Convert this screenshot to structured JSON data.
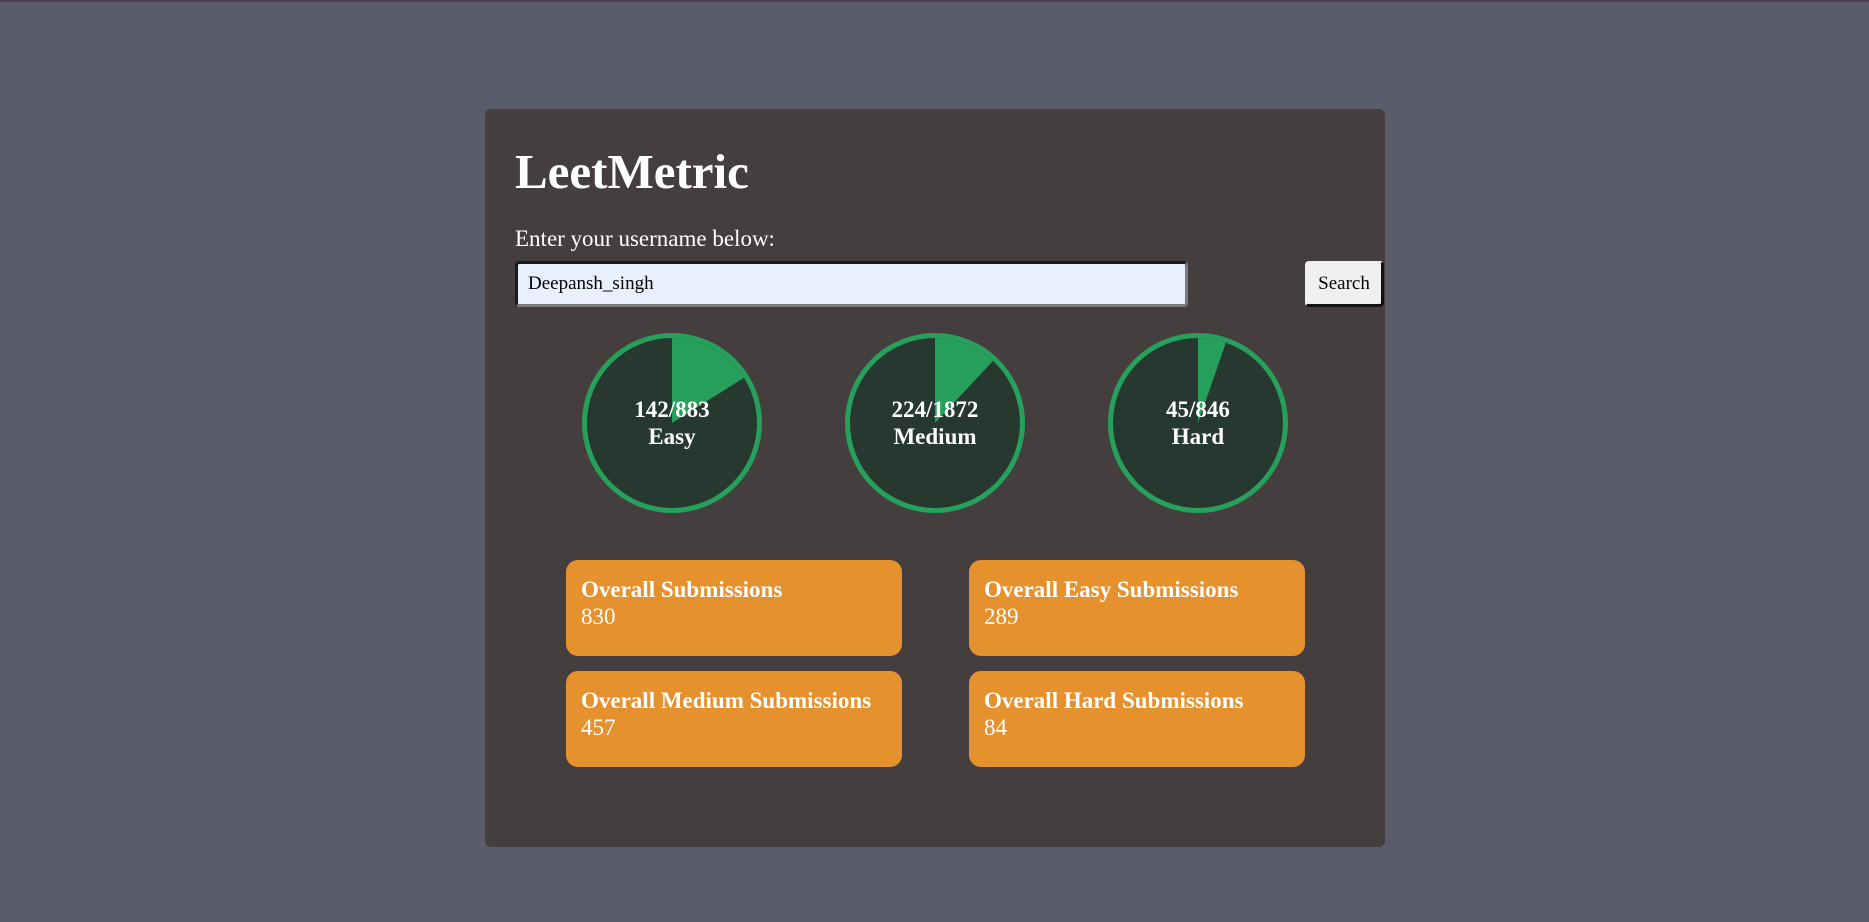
{
  "app": {
    "title": "LeetMetric",
    "subtitle": "Enter your username below:"
  },
  "search": {
    "value": "Deepansh_singh",
    "button_label": "Search"
  },
  "colors": {
    "page_bg": "#5b5c6b",
    "card_bg": "#443f3e",
    "progress_fill": "#26a05a",
    "progress_track": "#26382f",
    "stat_card_bg": "#e5912e"
  },
  "progress": [
    {
      "solved": 142,
      "total": 883,
      "label_value": "142/883",
      "label": "Easy"
    },
    {
      "solved": 224,
      "total": 1872,
      "label_value": "224/1872",
      "label": "Medium"
    },
    {
      "solved": 45,
      "total": 846,
      "label_value": "45/846",
      "label": "Hard"
    }
  ],
  "stats": [
    {
      "title": "Overall Submissions",
      "value": "830"
    },
    {
      "title": "Overall Easy Submissions",
      "value": "289"
    },
    {
      "title": "Overall Medium Submissions",
      "value": "457"
    },
    {
      "title": "Overall Hard Submissions",
      "value": "84"
    }
  ]
}
